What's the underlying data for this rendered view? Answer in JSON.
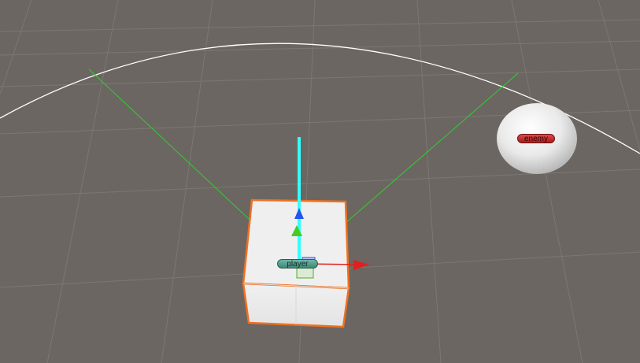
{
  "scene": {
    "background_color": "#6b6661",
    "grid_color": "#7c7772",
    "view_arc_color": "#ffffff",
    "view_cone_color": "#33cc33"
  },
  "player": {
    "label": "player",
    "label_color": "#5aa899",
    "cube_color": "#ececec",
    "selection_outline_color": "#f07020"
  },
  "enemy": {
    "label": "enemy",
    "label_color": "#d03030",
    "sphere_color": "#f2f2f2"
  },
  "gizmo": {
    "y_axis_color": "#33ffff",
    "x_axis_color": "#e02020",
    "z_handle_color": "#2255ee",
    "y_handle_color": "#44cc22",
    "center_square_color": "#55aa33"
  }
}
